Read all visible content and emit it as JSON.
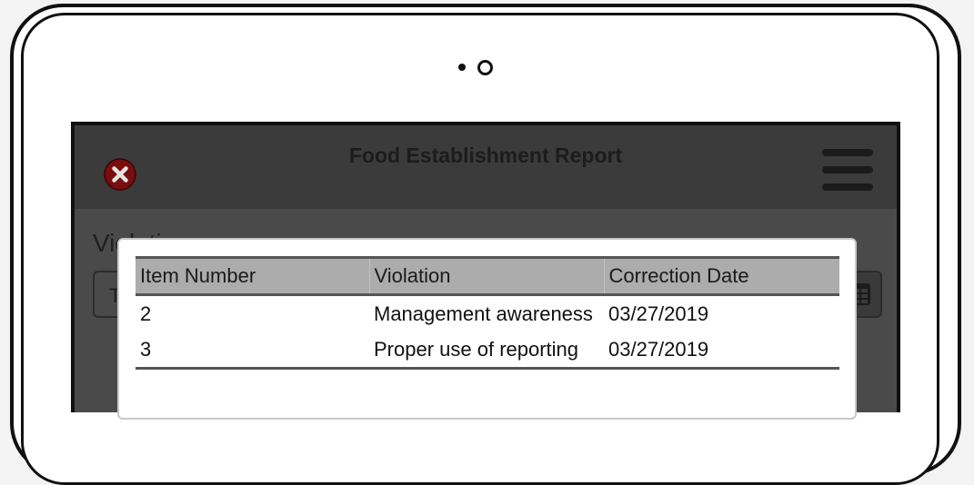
{
  "app": {
    "title": "Food Establishment Report"
  },
  "section": {
    "title": "Violations",
    "input_value": "T"
  },
  "icons": {
    "close": "close-icon",
    "menu": "hamburger-menu-icon",
    "calendar": "calendar-icon"
  },
  "colors": {
    "close_red": "#7a0d0d",
    "table_header": "#acacac"
  },
  "table": {
    "headers": [
      "Item Number",
      "Violation",
      "Correction Date"
    ],
    "rows": [
      [
        "2",
        "Management awareness",
        "03/27/2019"
      ],
      [
        "3",
        "Proper use of reporting",
        "03/27/2019"
      ]
    ]
  }
}
